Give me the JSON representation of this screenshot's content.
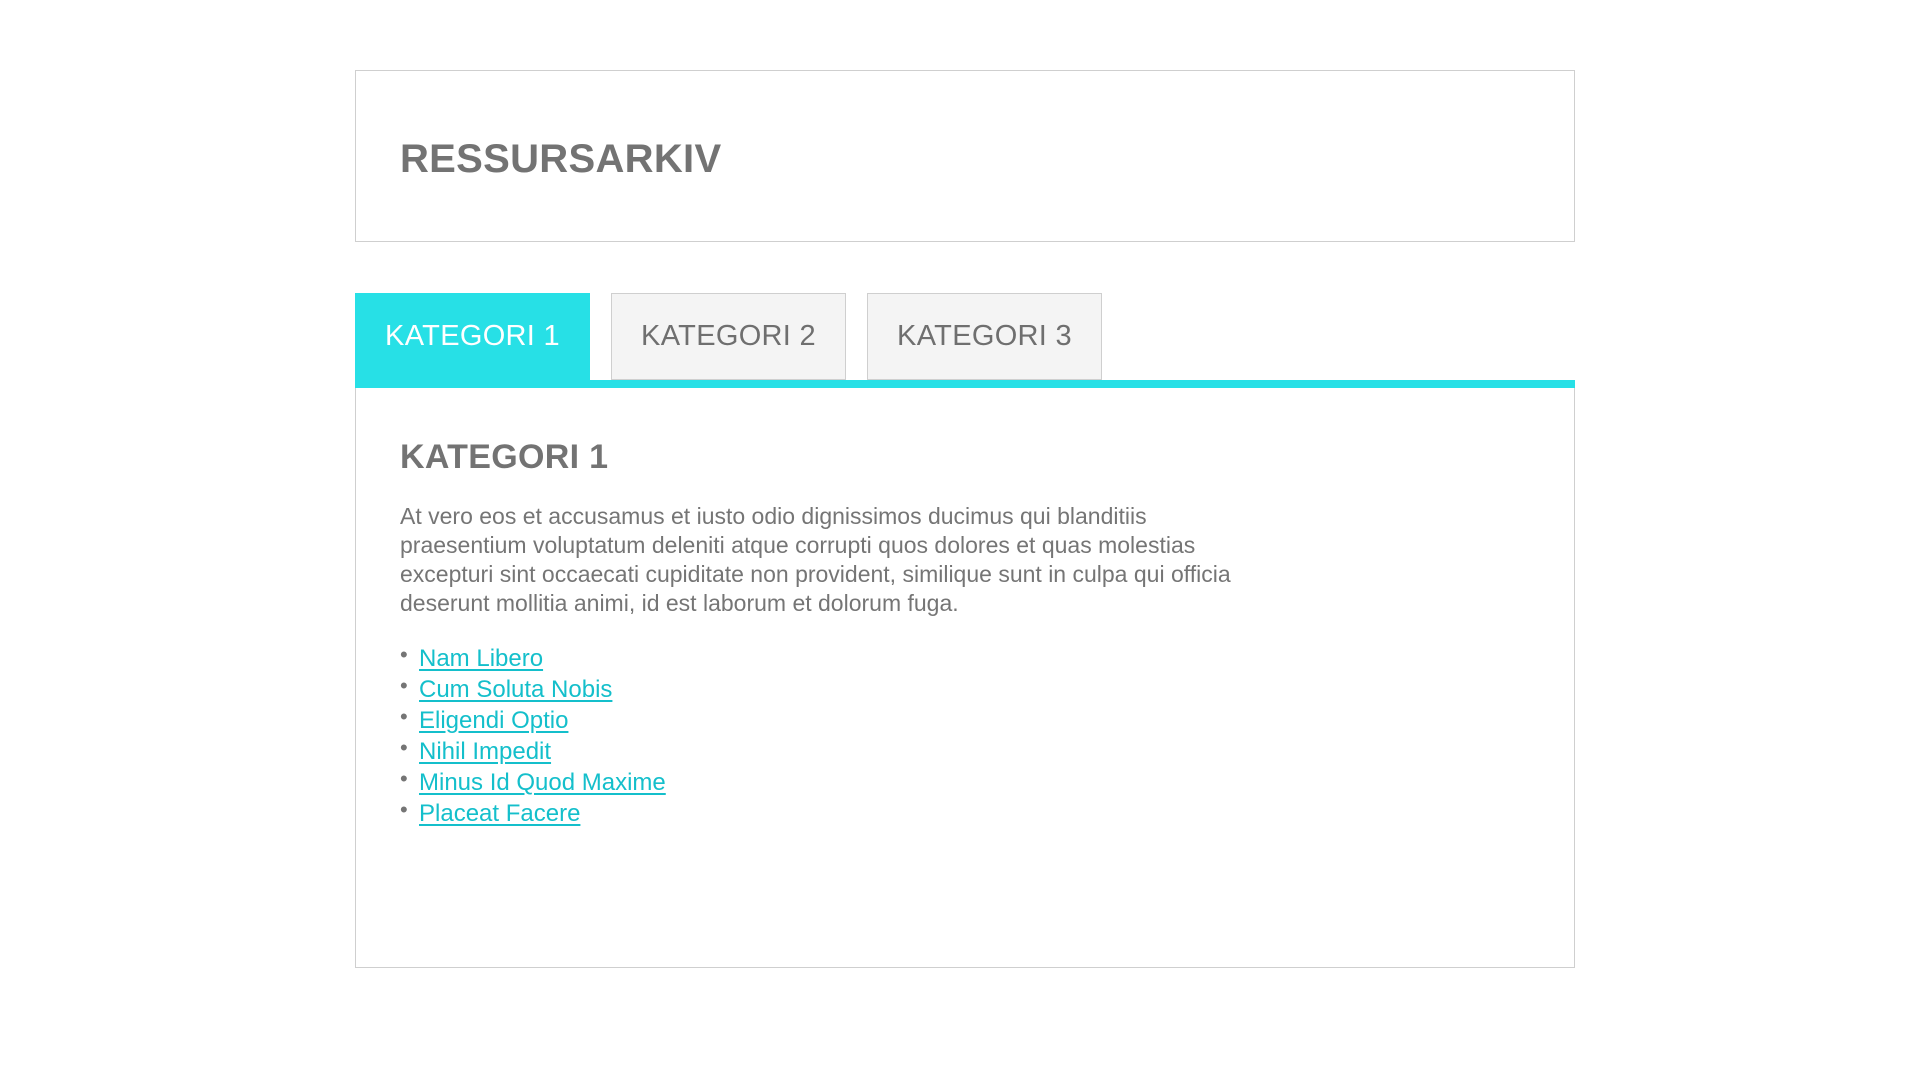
{
  "header": {
    "title": "RESSURSARKIV"
  },
  "tabs": [
    {
      "label": "KATEGORI 1",
      "active": true
    },
    {
      "label": "KATEGORI 2",
      "active": false
    },
    {
      "label": "KATEGORI 3",
      "active": false
    }
  ],
  "content": {
    "title": "KATEGORI 1",
    "text": "At vero eos et accusamus et iusto odio dignissimos ducimus qui blanditiis praesentium voluptatum deleniti atque corrupti quos dolores et quas molestias excepturi sint occaecati cupiditate non provident, similique sunt in culpa qui officia deserunt mollitia animi, id est laborum et dolorum fuga.",
    "links": [
      "Nam Libero",
      "Cum Soluta Nobis",
      "Eligendi Optio",
      "Nihil Impedit",
      "Minus Id Quod Maxime",
      "Placeat Facere"
    ]
  },
  "colors": {
    "accent": "#27e0e6",
    "link": "#14bfcb",
    "text": "#757575",
    "border": "#cfcfcf",
    "inactive_tab_bg": "#f4f4f4"
  }
}
